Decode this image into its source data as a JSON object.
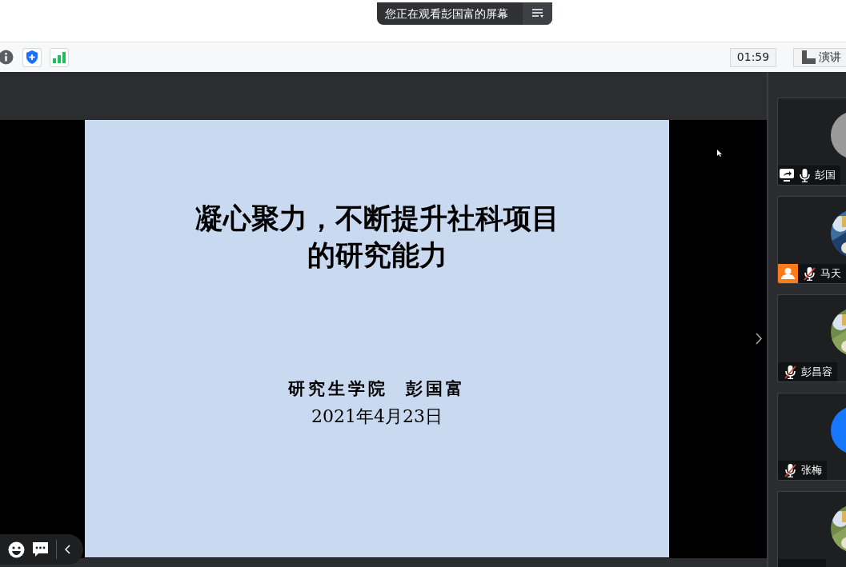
{
  "share_banner": {
    "text": "您正在观看彭国富的屏幕"
  },
  "toolbar": {
    "timer": "01:59",
    "view_button": "演讲"
  },
  "slide": {
    "title_lines": [
      "凝心聚力，不断提升社科项目",
      "的研究能力"
    ],
    "author": "研究生学院  彭国富",
    "date": "2021年4月23日"
  },
  "participants": [
    {
      "name": "彭国",
      "muted": false,
      "sharing": true,
      "avatar": {
        "kind": "default"
      }
    },
    {
      "name": "马天",
      "muted": true,
      "badge": true,
      "avatar": {
        "kind": "picture"
      }
    },
    {
      "name": "彭昌容",
      "muted": true,
      "avatar": {
        "kind": "picture"
      }
    },
    {
      "name": "张梅",
      "muted": true,
      "avatar": {
        "kind": "initial",
        "color": "#1677ff"
      }
    },
    {
      "avatar": {
        "kind": "picture"
      }
    }
  ]
}
